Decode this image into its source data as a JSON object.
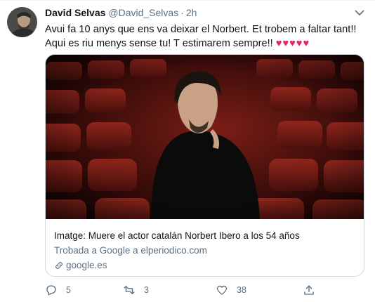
{
  "tweet": {
    "author_name": "David Selvas",
    "author_handle": "@David_Selvas",
    "separator": "·",
    "time": "2h",
    "text": "Avui fa 10 anys que ens va deixar el Norbert. Et trobem a faltar tant!! Aqui es riu menys sense tu! T estimarem sempre!!",
    "hearts": "♥♥♥♥♥"
  },
  "card": {
    "title": "Imatge: Muere el actor catalán Norbert Ibero a los 54 años",
    "subtitle": "Trobada a Google a elperiodico.com",
    "domain": "google.es"
  },
  "actions": {
    "replies": "5",
    "retweets": "3",
    "likes": "38"
  },
  "icons": {
    "more": "more-chevron-icon",
    "reply": "reply-icon",
    "retweet": "retweet-icon",
    "like": "heart-icon",
    "share": "share-icon",
    "link": "link-icon"
  },
  "colors": {
    "secondary_text": "#5b7083",
    "heart_red": "#e0245e",
    "border": "#cfd9de"
  }
}
